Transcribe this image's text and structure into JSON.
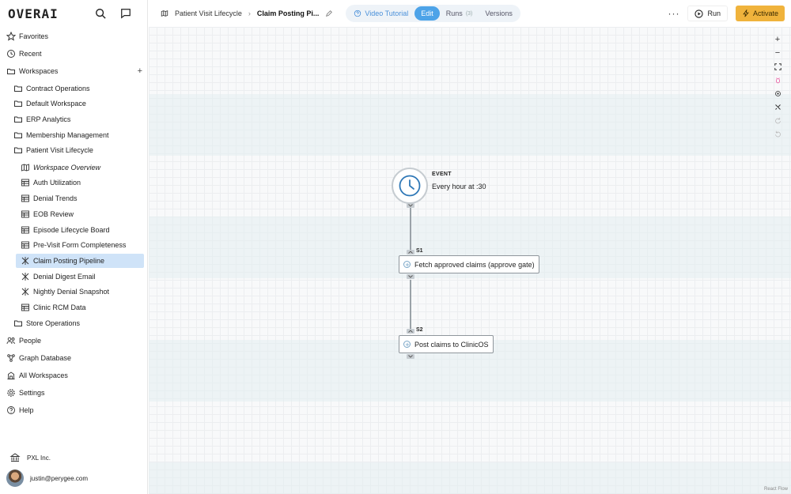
{
  "app": {
    "logo": "OVERAI"
  },
  "sidebar": {
    "top": [
      {
        "label": "Favorites",
        "icon": "star-icon"
      },
      {
        "label": "Recent",
        "icon": "clock-icon"
      },
      {
        "label": "Workspaces",
        "icon": "folder-stack-icon"
      }
    ],
    "workspaces": [
      {
        "label": "Contract Operations"
      },
      {
        "label": "Default Workspace"
      },
      {
        "label": "ERP Analytics"
      },
      {
        "label": "Membership Management"
      },
      {
        "label": "Patient Visit Lifecycle"
      }
    ],
    "children": [
      {
        "label": "Workspace Overview",
        "icon": "map-icon"
      },
      {
        "label": "Auth Utilization",
        "icon": "table-icon"
      },
      {
        "label": "Denial Trends",
        "icon": "table-icon"
      },
      {
        "label": "EOB Review",
        "icon": "table-icon"
      },
      {
        "label": "Episode Lifecycle Board",
        "icon": "table-icon"
      },
      {
        "label": "Pre-Visit Form Completeness",
        "icon": "table-icon"
      },
      {
        "label": "Claim Posting Pipeline",
        "icon": "workflow-icon"
      },
      {
        "label": "Denial Digest Email",
        "icon": "workflow-icon"
      },
      {
        "label": "Nightly Denial Snapshot",
        "icon": "workflow-icon"
      },
      {
        "label": "Clinic RCM Data",
        "icon": "table-icon"
      }
    ],
    "after": [
      {
        "label": "Store Operations"
      }
    ],
    "bottom": [
      {
        "label": "People"
      },
      {
        "label": "Graph Database"
      },
      {
        "label": "All Workspaces"
      },
      {
        "label": "Settings"
      },
      {
        "label": "Help"
      }
    ],
    "org": "PXL Inc.",
    "user": "justin@perygee.com"
  },
  "header": {
    "crumb_workspace": "Patient Visit Lifecycle",
    "crumb_sep": "›",
    "crumb_page": "Claim Posting Pi...",
    "tab_video": "Video Tutorial",
    "tab_edit": "Edit",
    "tab_runs": "Runs",
    "runs_count": "(3)",
    "tab_versions": "Versions",
    "more": "···",
    "run": "Run",
    "activate": "Activate"
  },
  "canvas": {
    "event_title": "EVENT",
    "event_schedule": "Every hour at :30",
    "steps": [
      {
        "id": "S1",
        "label": "Fetch approved claims (approve gate)"
      },
      {
        "id": "S2",
        "label": "Post claims to ClinicOS"
      }
    ],
    "attribution": "React Flow"
  }
}
